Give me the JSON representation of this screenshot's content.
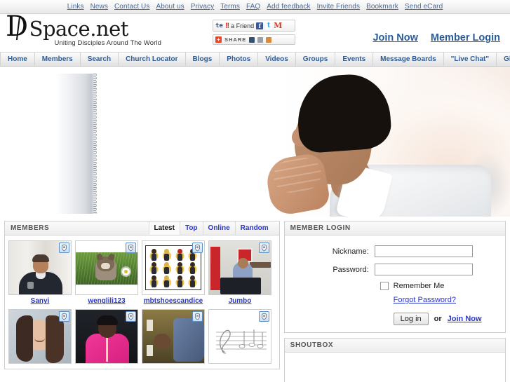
{
  "top_links": [
    "Links",
    "News",
    "Contact Us",
    "About us",
    "Privacy",
    "Terms",
    "FAQ",
    "Add feedback",
    "Invite Friends",
    "Bookmark",
    "Send eCard"
  ],
  "brand": {
    "logo_d": "D",
    "logo_rest": "Space.net",
    "tagline": "Uniting Disciples Around The World"
  },
  "tell_a_friend": {
    "tell": "te",
    "excl": "!!",
    "label": "a Friend",
    "facebook_icon": "facebook-icon",
    "twitter_icon": "twitter-icon",
    "gmail_icon": "gmail-icon"
  },
  "share": {
    "plus": "+",
    "label": "SHARE"
  },
  "auth": {
    "join": "Join Now",
    "login": "Member Login"
  },
  "nav": [
    "Home",
    "Members",
    "Search",
    "Church Locator",
    "Blogs",
    "Photos",
    "Videos",
    "Groups",
    "Events",
    "Message Boards",
    "\"Live Chat\"",
    "Global Prayers"
  ],
  "members_panel": {
    "title": "MEMBERS",
    "tabs": [
      {
        "label": "Latest",
        "active": true
      },
      {
        "label": "Top",
        "active": false
      },
      {
        "label": "Online",
        "active": false
      },
      {
        "label": "Random",
        "active": false
      }
    ],
    "thumbnails": [
      {
        "username": "Sanyi",
        "photo": "man-in-dark-polo-shirt",
        "badge": "award-badge-icon"
      },
      {
        "username": "wenglili123",
        "photo": "cat-in-grass-with-daisy",
        "badge": "award-badge-icon"
      },
      {
        "username": "mbtshoescandice",
        "photo": "grid-of-chibi-characters",
        "badge": "award-badge-icon"
      },
      {
        "username": "Jumbo",
        "photo": "person-at-desk-with-monitor",
        "badge": "award-badge-icon"
      },
      {
        "username": "",
        "photo": "woman-with-long-dark-hair",
        "badge": "award-badge-icon"
      },
      {
        "username": "",
        "photo": "woman-in-pink-jacket",
        "badge": "award-badge-icon"
      },
      {
        "username": "",
        "photo": "person-in-blue-jeans-sideways",
        "badge": "award-badge-icon"
      },
      {
        "username": "",
        "photo": "treble-clef-music-staff-drawing",
        "badge": "award-badge-icon"
      }
    ]
  },
  "login_panel": {
    "title": "MEMBER LOGIN",
    "nickname_label": "Nickname:",
    "nickname_value": "",
    "password_label": "Password:",
    "password_value": "",
    "remember_label": "Remember Me",
    "forgot_label": "Forgot Password?",
    "login_button": "Log in",
    "or_text": "or",
    "join_link": "Join Now"
  },
  "shoutbox": {
    "title": "SHOUTBOX"
  },
  "hero": {
    "description": "man-praying-hands-clasped"
  },
  "colors": {
    "link_blue": "#2a36c8",
    "nav_blue": "#2f5c94",
    "auth_blue": "#2a5c9a",
    "toplink_blue": "#4a6a96",
    "panel_header": "#ededed"
  }
}
